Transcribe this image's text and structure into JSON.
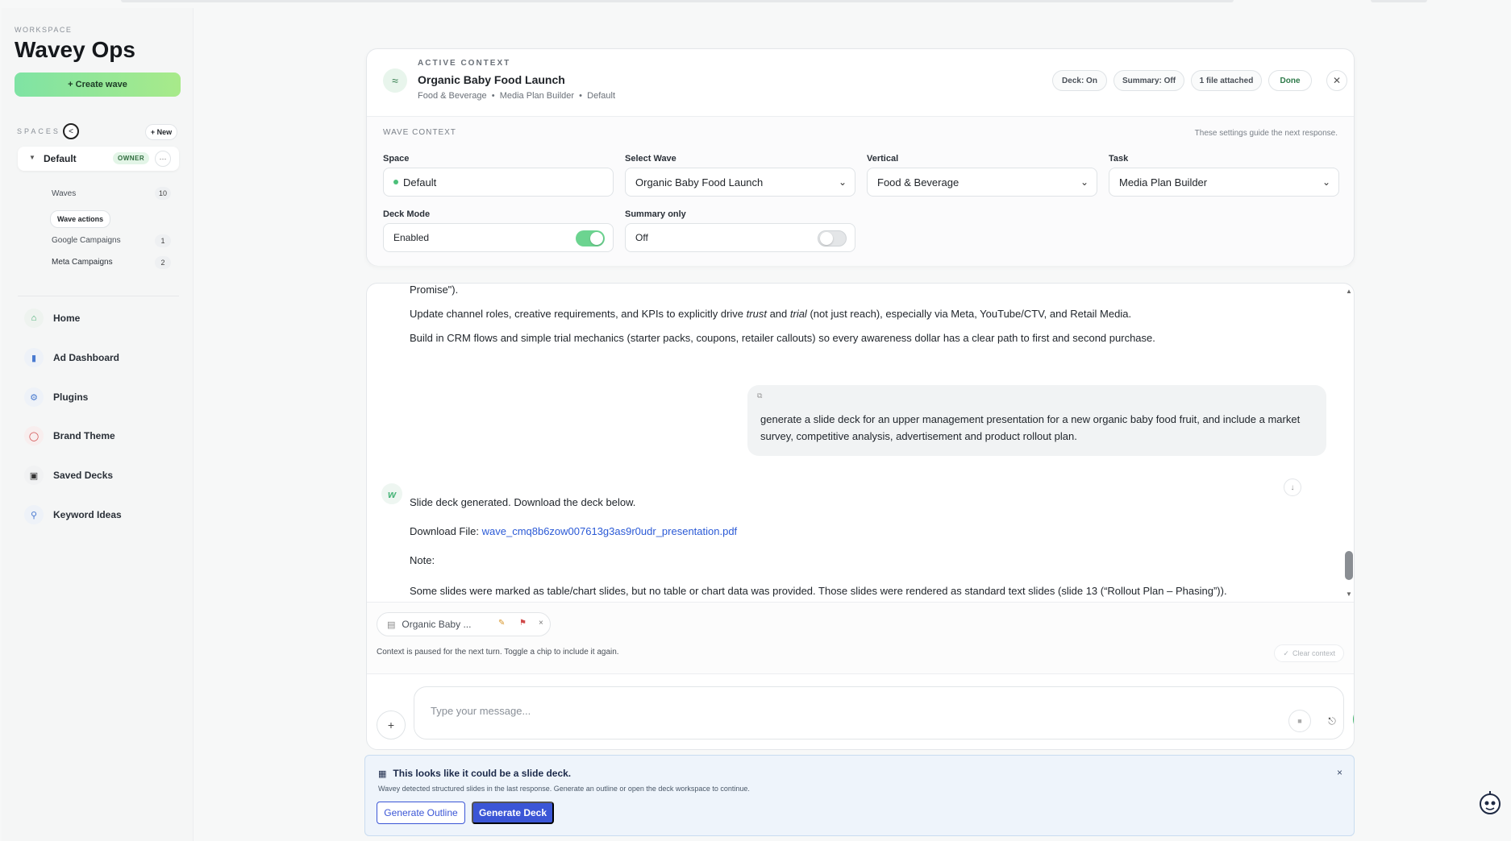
{
  "sidebar": {
    "workspace_label": "WORKSPACE",
    "workspace_title": "Wavey Ops",
    "create_label": "+ Create wave",
    "spaces_label": "SPACES",
    "collapse_glyph": "<",
    "new_label": "+ New",
    "space": {
      "name": "Default",
      "badge": "OWNER",
      "more": "···"
    },
    "sub_items": [
      {
        "label": "Waves",
        "count": "10"
      },
      {
        "label": "Google Campaigns",
        "count": "1"
      },
      {
        "label": "Meta Campaigns",
        "count": "2"
      }
    ],
    "wave_actions_label": "Wave actions",
    "nav": [
      {
        "label": "Home",
        "icon": "home-icon",
        "color": "#3aa86a"
      },
      {
        "label": "Ad Dashboard",
        "icon": "bar-chart-icon",
        "color": "#4a7bd0"
      },
      {
        "label": "Plugins",
        "icon": "plugin-icon",
        "color": "#4a7bd0"
      },
      {
        "label": "Brand Theme",
        "icon": "palette-icon",
        "color": "#d04a4a"
      },
      {
        "label": "Saved Decks",
        "icon": "bookmark-icon",
        "color": "#333333"
      },
      {
        "label": "Keyword Ideas",
        "icon": "search-icon",
        "color": "#4a7bd0"
      }
    ]
  },
  "context": {
    "label": "ACTIVE CONTEXT",
    "title": "Organic Baby Food Launch",
    "breadcrumb": [
      "Food & Beverage",
      "Media Plan Builder",
      "Default"
    ],
    "chips": {
      "deck": "Deck: On",
      "summary": "Summary: Off",
      "files": "1 file attached",
      "done": "Done"
    },
    "wave_context_label": "WAVE CONTEXT",
    "note": "These settings guide the next response.",
    "fields": {
      "space": {
        "label": "Space",
        "value": "Default"
      },
      "wave": {
        "label": "Select Wave",
        "value": "Organic Baby Food Launch"
      },
      "vertical": {
        "label": "Vertical",
        "value": "Food & Beverage"
      },
      "task": {
        "label": "Task",
        "value": "Media Plan Builder"
      },
      "deck_mode": {
        "label": "Deck Mode",
        "value": "Enabled",
        "on": true
      },
      "summary_only": {
        "label": "Summary only",
        "value": "Off",
        "on": false
      }
    }
  },
  "chat": {
    "prev_lines": {
      "line0": "Promise\").",
      "line1_a": "Update channel roles, creative requirements, and KPIs to explicitly drive ",
      "line1_em1": "trust",
      "line1_b": " and ",
      "line1_em2": "trial",
      "line1_c": " (not just reach), especially via Meta, YouTube/CTV, and Retail Media.",
      "line2": "Build in CRM flows and simple trial mechanics (starter packs, coupons, retailer callouts) so every awareness dollar has a clear path to first and second purchase."
    },
    "user_message": "generate a slide deck for an upper management presentation for a new organic baby food fruit, and include a market survey, competitive analysis, advertisement and product rollout plan.",
    "bot": {
      "line1": "Slide deck generated. Download the deck below.",
      "download_prefix": "Download File: ",
      "download_link": "wave_cmq8b6zow007613g3as9r0udr_presentation.pdf",
      "note": "Note:",
      "warning": "Some slides were marked as table/chart slides, but no table or chart data was provided. Those slides were rendered as standard text slides (slide 13 (“Rollout Plan – Phasing”))."
    },
    "file_chip": "Organic Baby ...",
    "context_hint": "Context is paused for the next turn. Toggle a chip to include it again.",
    "clear_context": "Clear context",
    "placeholder": "Type your message..."
  },
  "banner": {
    "title": "This looks like it could be a slide deck.",
    "subtitle": "Wavey detected structured slides in the last response. Generate an outline or open the deck workspace to continue.",
    "outline_btn": "Generate Outline",
    "deck_btn": "Generate Deck"
  }
}
